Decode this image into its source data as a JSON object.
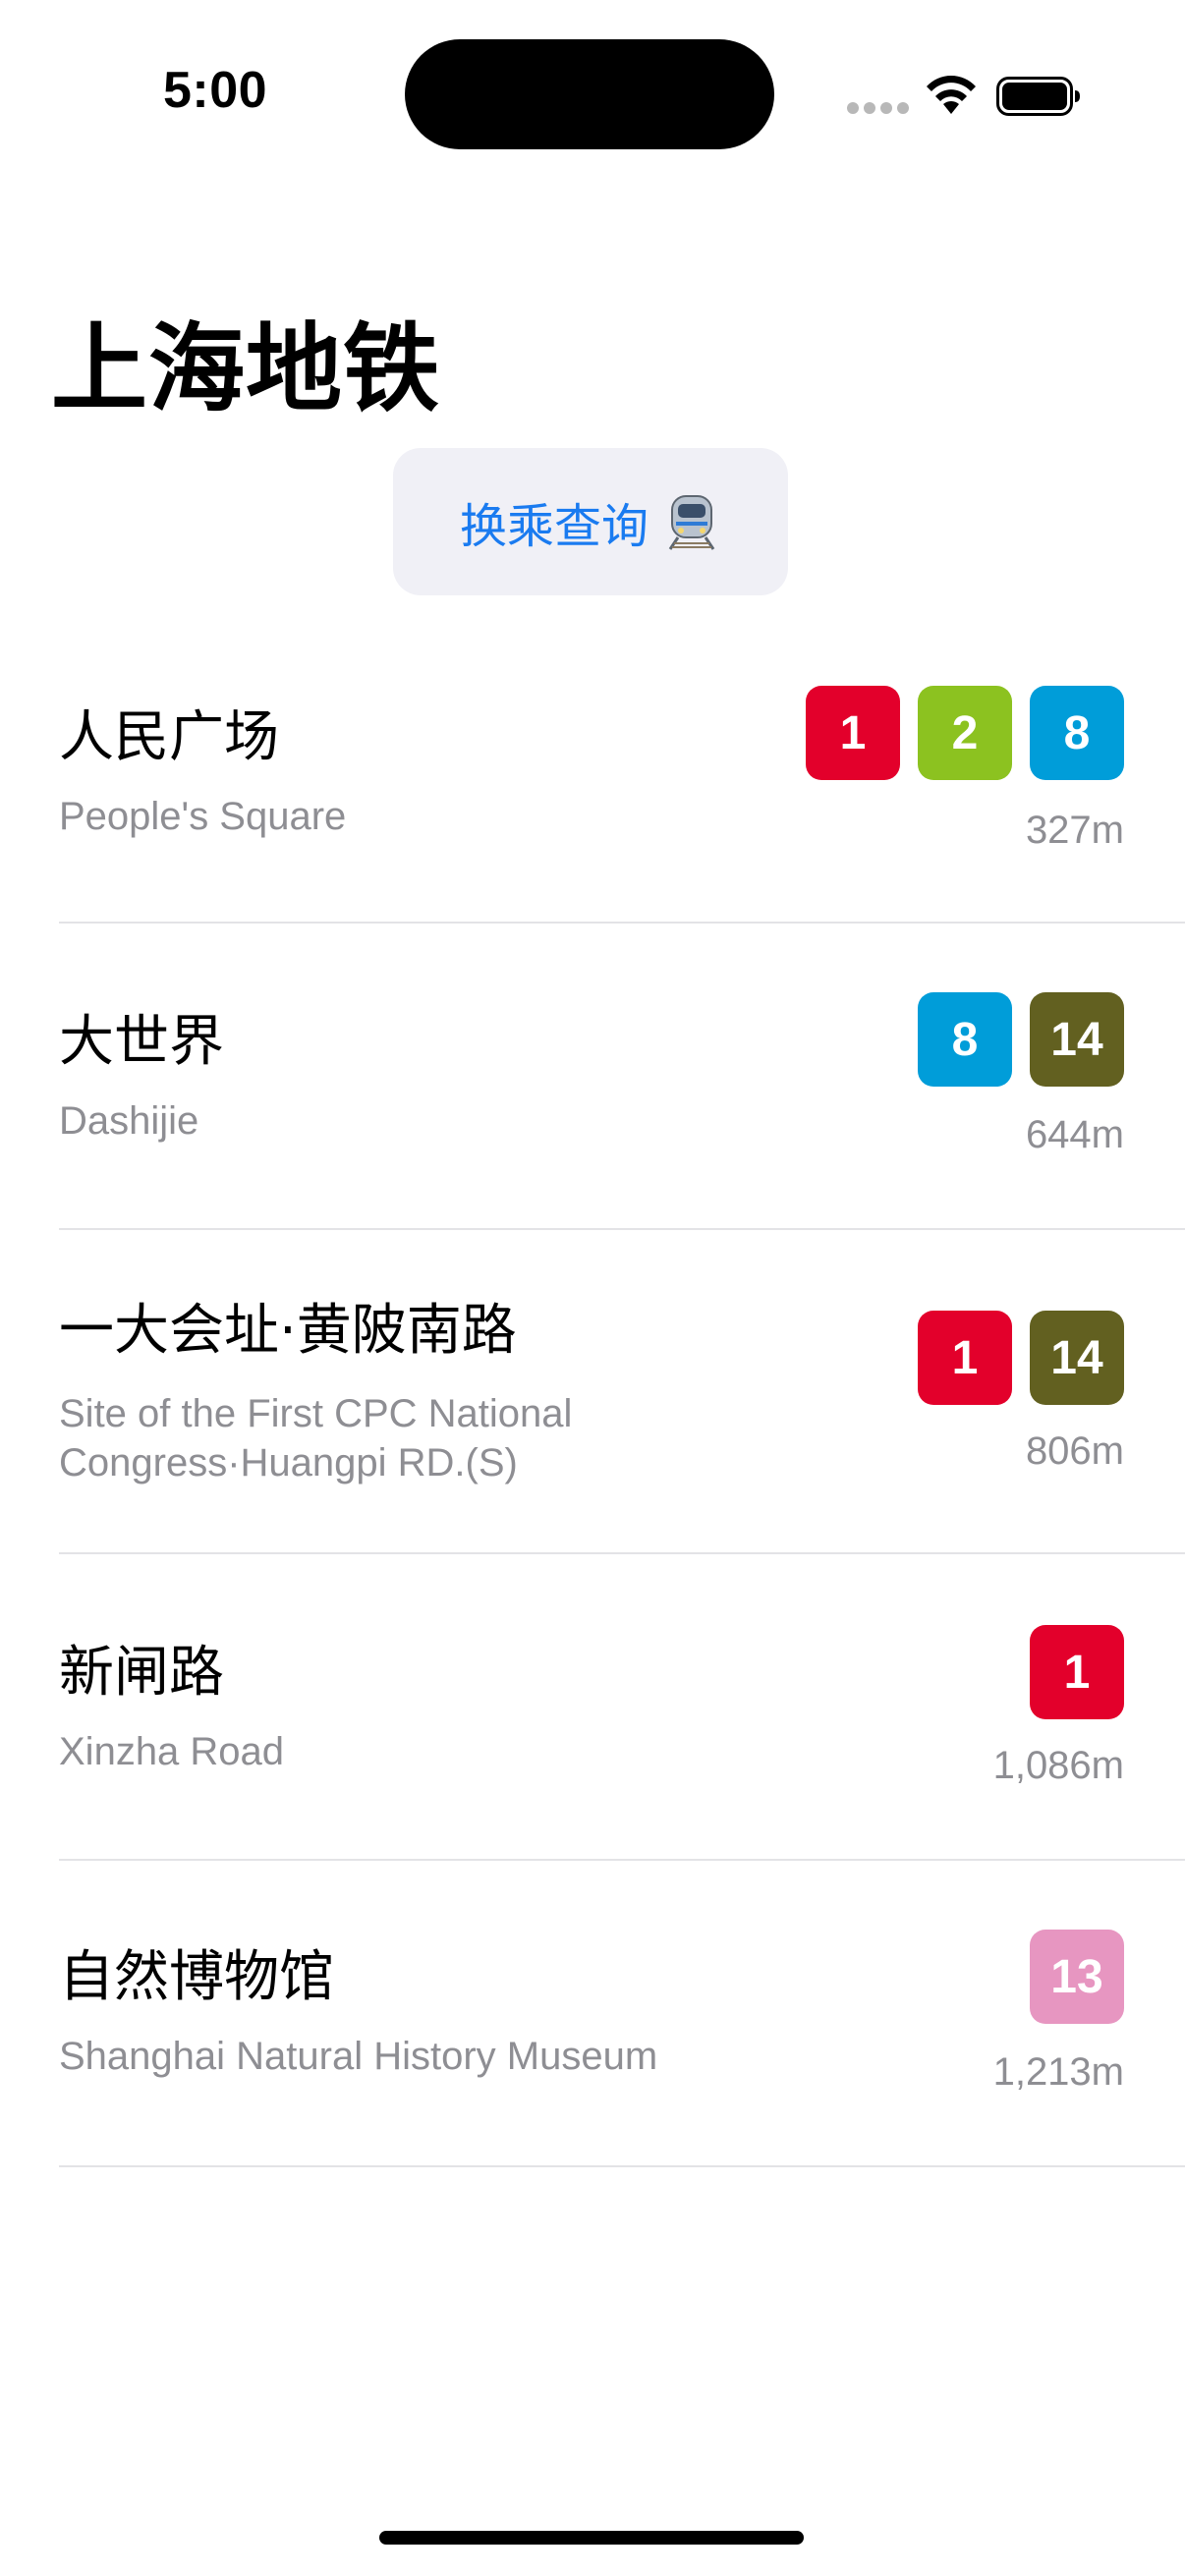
{
  "status_bar": {
    "time": "5:00"
  },
  "title": "上海地铁",
  "transfer_button": {
    "label": "换乘查询",
    "icon": "train-icon"
  },
  "line_colors": {
    "1": "#e3002b",
    "2": "#8cc220",
    "8": "#009dd9",
    "13": "#e796c1",
    "14": "#626020"
  },
  "stations": [
    {
      "name": "人民广场",
      "name_en": "People's Square",
      "lines": [
        "1",
        "2",
        "8"
      ],
      "distance": "327m"
    },
    {
      "name": "大世界",
      "name_en": "Dashijie",
      "lines": [
        "8",
        "14"
      ],
      "distance": "644m"
    },
    {
      "name": "一大会址·黄陂南路",
      "name_en": "Site of the First CPC National Congress·Huangpi RD.(S)",
      "lines": [
        "1",
        "14"
      ],
      "distance": "806m"
    },
    {
      "name": "新闸路",
      "name_en": "Xinzha Road",
      "lines": [
        "1"
      ],
      "distance": "1,086m"
    },
    {
      "name": "自然博物馆",
      "name_en": "Shanghai Natural History Museum",
      "lines": [
        "13"
      ],
      "distance": "1,213m"
    }
  ]
}
